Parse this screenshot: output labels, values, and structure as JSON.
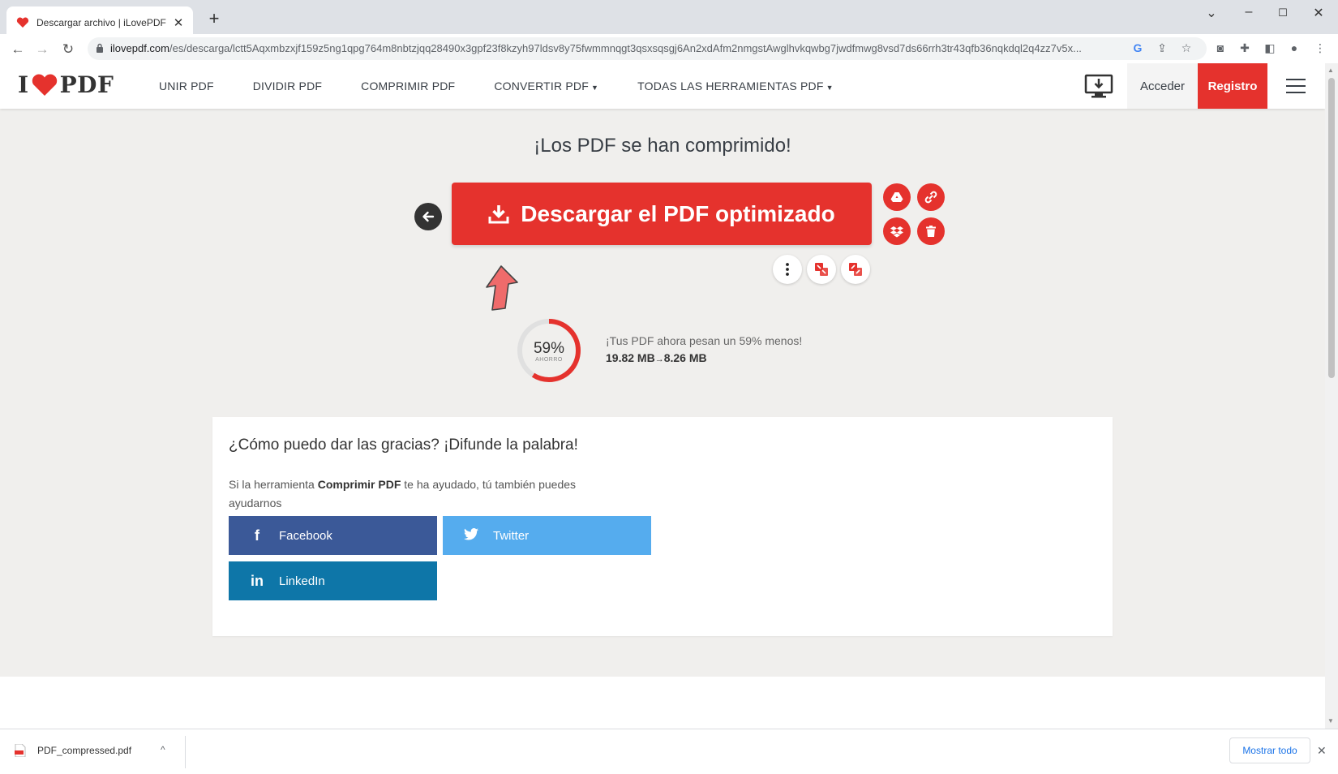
{
  "browser": {
    "tab_title": "Descargar archivo | iLovePDF",
    "tab_close": "✕",
    "new_tab": "+",
    "url_host": "ilovepdf.com",
    "url_path": "/es/descarga/lctt5Aqxmbzxjf159z5ng1qpg764m8nbtzjqq28490x3gpf23f8kzyh97ldsv8y75fwmmnqgt3qsxsqsgj6An2xdAfm2nmgstAwglhvkqwbg7jwdfmwg8vsd7ds66rrh3tr43qfb36nqkdql2q4zz7v5x..."
  },
  "header": {
    "logo_left": "I",
    "logo_right": "PDF",
    "menu": [
      "UNIR PDF",
      "DIVIDIR PDF",
      "COMPRIMIR PDF",
      "CONVERTIR PDF",
      "TODAS LAS HERRAMIENTAS PDF"
    ],
    "login": "Acceder",
    "register": "Registro"
  },
  "main": {
    "headline": "¡Los PDF se han comprimido!",
    "download_label": "Descargar el PDF optimizado",
    "gauge_percent": "59%",
    "gauge_sub": "AHORRO",
    "gauge_fraction": 0.59,
    "savings_msg": "¡Tus PDF ahora pesan un 59% menos!",
    "size_before": "19.82 MB",
    "size_after": "8.26 MB"
  },
  "share": {
    "title": "¿Cómo puedo dar las gracias? ¡Difunde la palabra!",
    "text_before": "Si la herramienta ",
    "text_bold": "Comprimir PDF",
    "text_after": " te ha ayudado, tú también puedes ayudarnos",
    "facebook": "Facebook",
    "twitter": "Twitter",
    "linkedin": "LinkedIn"
  },
  "downloads": {
    "file_name": "PDF_compressed.pdf",
    "show_all": "Mostrar todo"
  },
  "colors": {
    "brand_red": "#e5322d",
    "facebook": "#3b5998",
    "twitter": "#55acee",
    "linkedin": "#0e76a8"
  }
}
